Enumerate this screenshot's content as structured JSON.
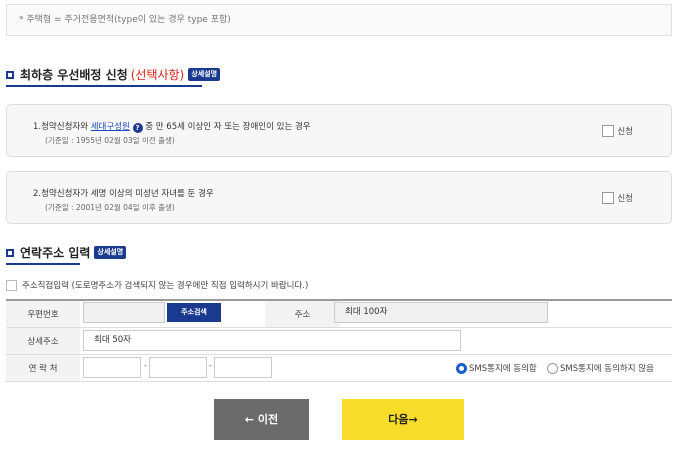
{
  "note": "* 주택형 = 주거전용면적(type이 있는 경우 type 포함)",
  "priority": {
    "title": "최하층 우선배정 신청",
    "title_highlight": "(선택사항)",
    "detail_badge": "상세설명",
    "options": [
      {
        "text_before": "1.청약신청자와 ",
        "link": "세대구성원",
        "help_icon": "question-icon",
        "text_after": " 중 만 65세 이상인 자 또는 장애인이 있는 경우",
        "sub": "(기준일 : 1955년 02월 03일 이전 출생)",
        "checkbox_label": "신청",
        "checked": false
      },
      {
        "text_before": "2.청약신청자가 세명 이상의 미성년 자녀를 둔 경우",
        "link": "",
        "help_icon": "",
        "text_after": "",
        "sub": "(기준일 : 2001년 02월 04일 이후 출생)",
        "checkbox_label": "신청",
        "checked": false
      }
    ]
  },
  "contact": {
    "title": "연락주소 입력",
    "detail_badge": "상세설명",
    "direct_input_label": "주소직접입력 (도로명주소가 검색되지 않는 경우에만 직접 입력하시기 바랍니다.)",
    "direct_input_checked": false,
    "postal_label": "우편번호",
    "postal_value": "",
    "search_button": "주소검색",
    "address_label": "주소",
    "address_value": "최대 100자",
    "detail_label": "상세주소",
    "detail_value": "최대 50자",
    "phone_label": "연 락 처",
    "phone_parts": [
      "",
      "",
      ""
    ],
    "phone_separator": "-",
    "sms_agree": "SMS통지에 동의함",
    "sms_disagree": "SMS통지에 동의하지 않음",
    "sms_selected": "agree"
  },
  "buttons": {
    "prev": "← 이전",
    "next": "다음→"
  },
  "colors": {
    "accent": "#1a3a8f",
    "highlight": "#d9241b",
    "next_button": "#f7dd2a",
    "prev_button": "#6b6b6b"
  }
}
